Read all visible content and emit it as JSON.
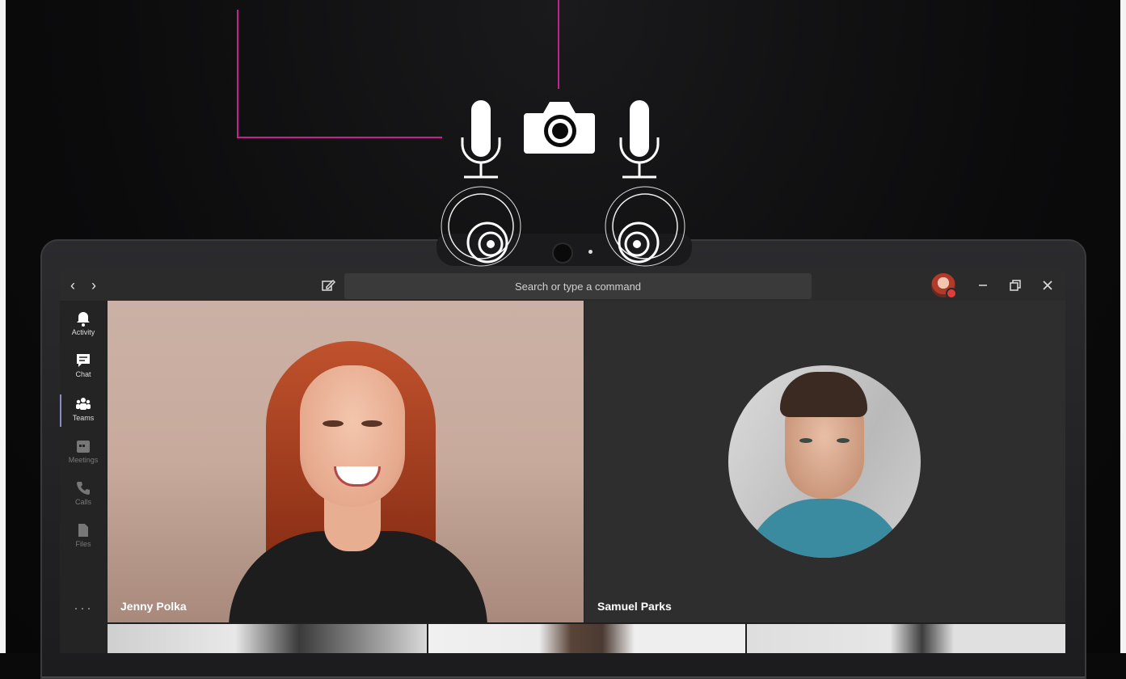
{
  "app": {
    "search_placeholder": "Search or type a command"
  },
  "rail": [
    {
      "label": "Activity",
      "icon": "bell-icon"
    },
    {
      "label": "Chat",
      "icon": "chat-icon"
    },
    {
      "label": "Teams",
      "icon": "teams-icon"
    },
    {
      "label": "Meetings",
      "icon": "calendar-icon"
    },
    {
      "label": "Calls",
      "icon": "phone-icon"
    },
    {
      "label": "Files",
      "icon": "file-icon"
    }
  ],
  "rail_more": "···",
  "participants": [
    {
      "name": "Jenny Polka"
    },
    {
      "name": "Samuel Parks"
    }
  ],
  "colors": {
    "accent": "#c2248f",
    "rail_active": "#8b8cc7",
    "status": "#e23b3b"
  }
}
